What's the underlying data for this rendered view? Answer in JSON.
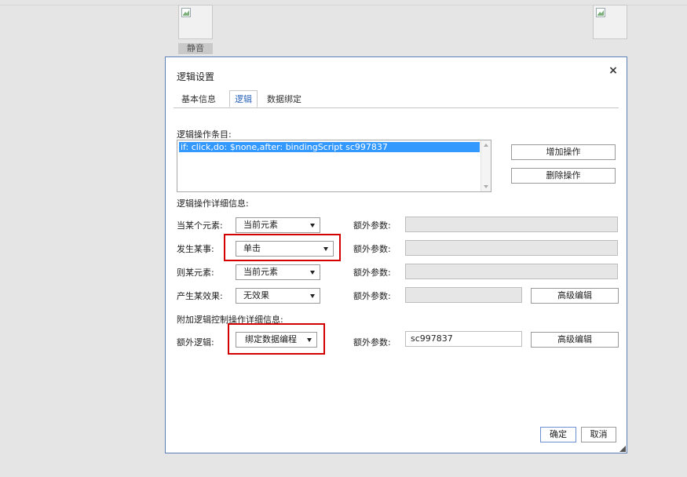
{
  "background": {
    "thumb_label": "静音"
  },
  "dialog": {
    "title": "逻辑设置",
    "close_glyph": "×",
    "tabs": [
      {
        "label": "基本信息",
        "active": false
      },
      {
        "label": "逻辑",
        "active": true
      },
      {
        "label": "数据绑定",
        "active": false
      }
    ],
    "logic_items_label": "逻辑操作条目:",
    "logic_items": [
      "if: click,do: $none,after: bindingScript sc997837"
    ],
    "add_action_label": "增加操作",
    "delete_action_label": "删除操作",
    "detail_section_label": "逻辑操作详细信息:",
    "rows": [
      {
        "label": "当某个元素:",
        "value": "当前元素",
        "extra_label": "额外参数:",
        "extra_value": ""
      },
      {
        "label": "发生某事:",
        "value": "单击",
        "extra_label": "额外参数:",
        "extra_value": ""
      },
      {
        "label": "则某元素:",
        "value": "当前元素",
        "extra_label": "额外参数:",
        "extra_value": ""
      },
      {
        "label": "产生某效果:",
        "value": "无效果",
        "extra_label": "额外参数:",
        "extra_value": "",
        "advanced_label": "高级编辑"
      }
    ],
    "extra_section_label": "附加逻辑控制操作详细信息:",
    "extra_logic": {
      "label": "额外逻辑:",
      "value": "绑定数据编程",
      "extra_label": "额外参数:",
      "extra_value": "sc997837",
      "advanced_label": "高级编辑"
    },
    "ok_label": "确定",
    "cancel_label": "取消"
  },
  "colors": {
    "accent": "#2a63b8",
    "selection": "#3399ff",
    "highlight": "#d40000"
  }
}
